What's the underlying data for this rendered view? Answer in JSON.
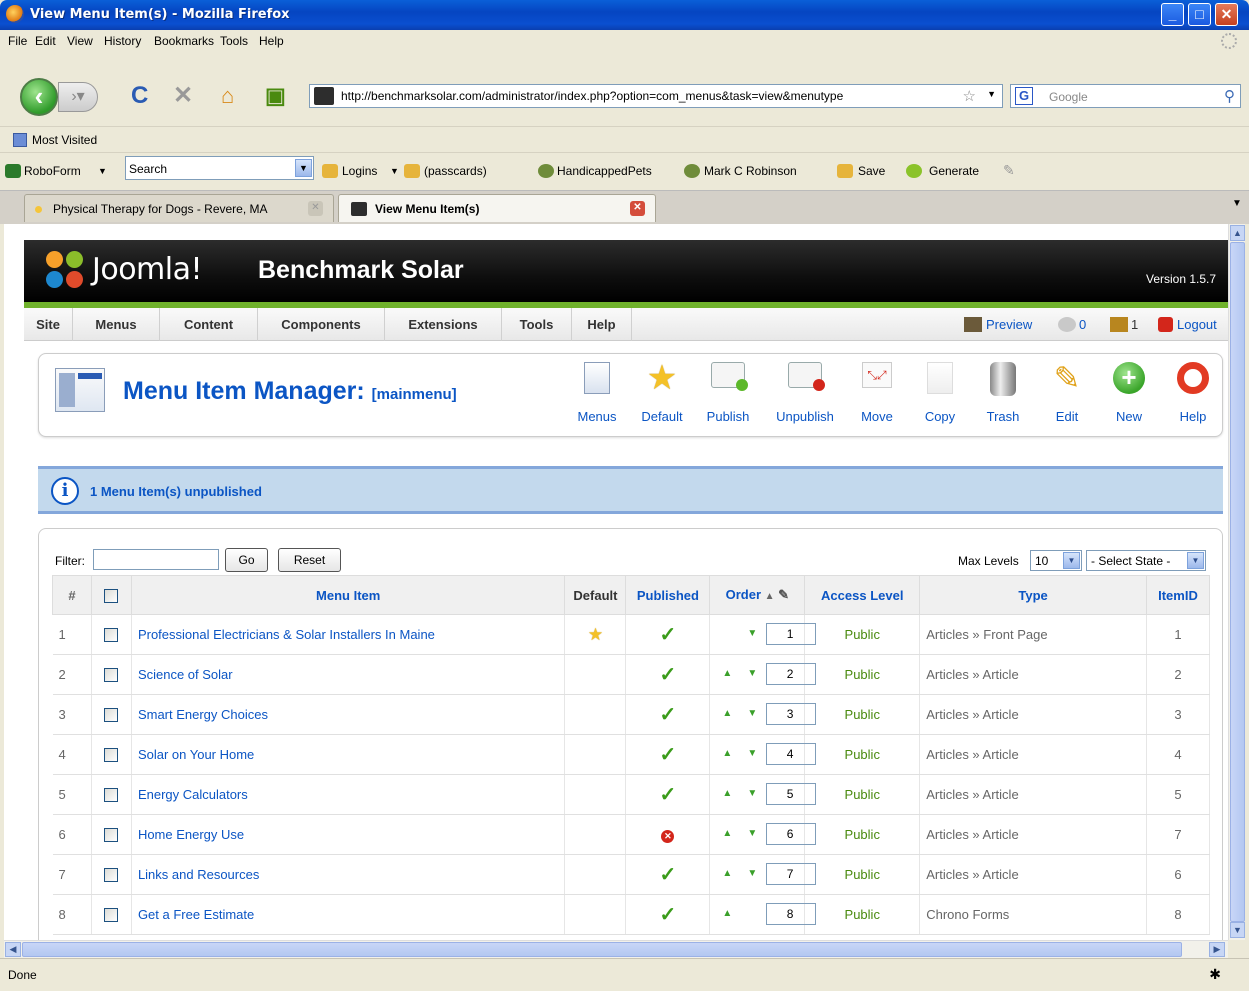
{
  "window": {
    "title": "View Menu Item(s) - Mozilla Firefox",
    "buttons": [
      "_",
      "□",
      "X"
    ]
  },
  "menubar": [
    "File",
    "Edit",
    "View",
    "History",
    "Bookmarks",
    "Tools",
    "Help"
  ],
  "nav": {
    "url": "http://benchmarksolar.com/administrator/index.php?option=com_menus&task=view&menutype",
    "search_placeholder": "Google",
    "search_engine_letter": "G"
  },
  "bookmarks": {
    "most_visited": "Most Visited"
  },
  "roboform": {
    "label": "RoboForm",
    "search_value": "Search",
    "items": [
      "Logins",
      "(passcards)",
      "HandicappedPets",
      "Mark C Robinson",
      "Save",
      "Generate"
    ]
  },
  "tabs": [
    {
      "label": "Physical Therapy for Dogs - Revere, MA",
      "active": false
    },
    {
      "label": "View Menu Item(s)",
      "active": true
    }
  ],
  "joomla": {
    "brand": "Joomla!",
    "site_name": "Benchmark Solar",
    "version": "Version 1.5.7",
    "menu": [
      "Site",
      "Menus",
      "Content",
      "Components",
      "Extensions",
      "Tools",
      "Help"
    ],
    "right": {
      "preview": "Preview",
      "messages": "0",
      "users": "1",
      "logout": "Logout"
    },
    "manager_title": "Menu Item Manager:",
    "manager_sub": "[mainmenu]",
    "toolbar": [
      "Menus",
      "Default",
      "Publish",
      "Unpublish",
      "Move",
      "Copy",
      "Trash",
      "Edit",
      "New",
      "Help"
    ],
    "message": "1 Menu Item(s) unpublished",
    "filter": {
      "label": "Filter:",
      "value": "",
      "go": "Go",
      "reset": "Reset",
      "max_levels_label": "Max Levels",
      "max_levels_value": "10",
      "state_value": "- Select State -"
    },
    "columns": [
      "#",
      "",
      "Menu Item",
      "Default",
      "Published",
      "Order",
      "Access Level",
      "Type",
      "ItemID"
    ],
    "rows": [
      {
        "num": "1",
        "name": "Professional Electricians & Solar Installers In Maine",
        "default": true,
        "published": true,
        "order": "1",
        "up": false,
        "down": true,
        "access": "Public",
        "type": "Articles » Front Page",
        "itemid": "1"
      },
      {
        "num": "2",
        "name": "Science of Solar",
        "default": false,
        "published": true,
        "order": "2",
        "up": true,
        "down": true,
        "access": "Public",
        "type": "Articles » Article",
        "itemid": "2"
      },
      {
        "num": "3",
        "name": "Smart Energy Choices",
        "default": false,
        "published": true,
        "order": "3",
        "up": true,
        "down": true,
        "access": "Public",
        "type": "Articles » Article",
        "itemid": "3"
      },
      {
        "num": "4",
        "name": "Solar on Your Home",
        "default": false,
        "published": true,
        "order": "4",
        "up": true,
        "down": true,
        "access": "Public",
        "type": "Articles » Article",
        "itemid": "4"
      },
      {
        "num": "5",
        "name": "Energy Calculators",
        "default": false,
        "published": true,
        "order": "5",
        "up": true,
        "down": true,
        "access": "Public",
        "type": "Articles » Article",
        "itemid": "5"
      },
      {
        "num": "6",
        "name": "Home Energy Use",
        "default": false,
        "published": false,
        "order": "6",
        "up": true,
        "down": true,
        "access": "Public",
        "type": "Articles » Article",
        "itemid": "7"
      },
      {
        "num": "7",
        "name": "Links and Resources",
        "default": false,
        "published": true,
        "order": "7",
        "up": true,
        "down": true,
        "access": "Public",
        "type": "Articles » Article",
        "itemid": "6"
      },
      {
        "num": "8",
        "name": "Get a Free Estimate",
        "default": false,
        "published": true,
        "order": "8",
        "up": true,
        "down": false,
        "access": "Public",
        "type": "Chrono Forms",
        "itemid": "8"
      }
    ]
  },
  "status": "Done",
  "colors": {
    "joomla_blue": "#0b55c4",
    "joomla_green": "#70b22c",
    "titlebar": "#0545c1"
  }
}
